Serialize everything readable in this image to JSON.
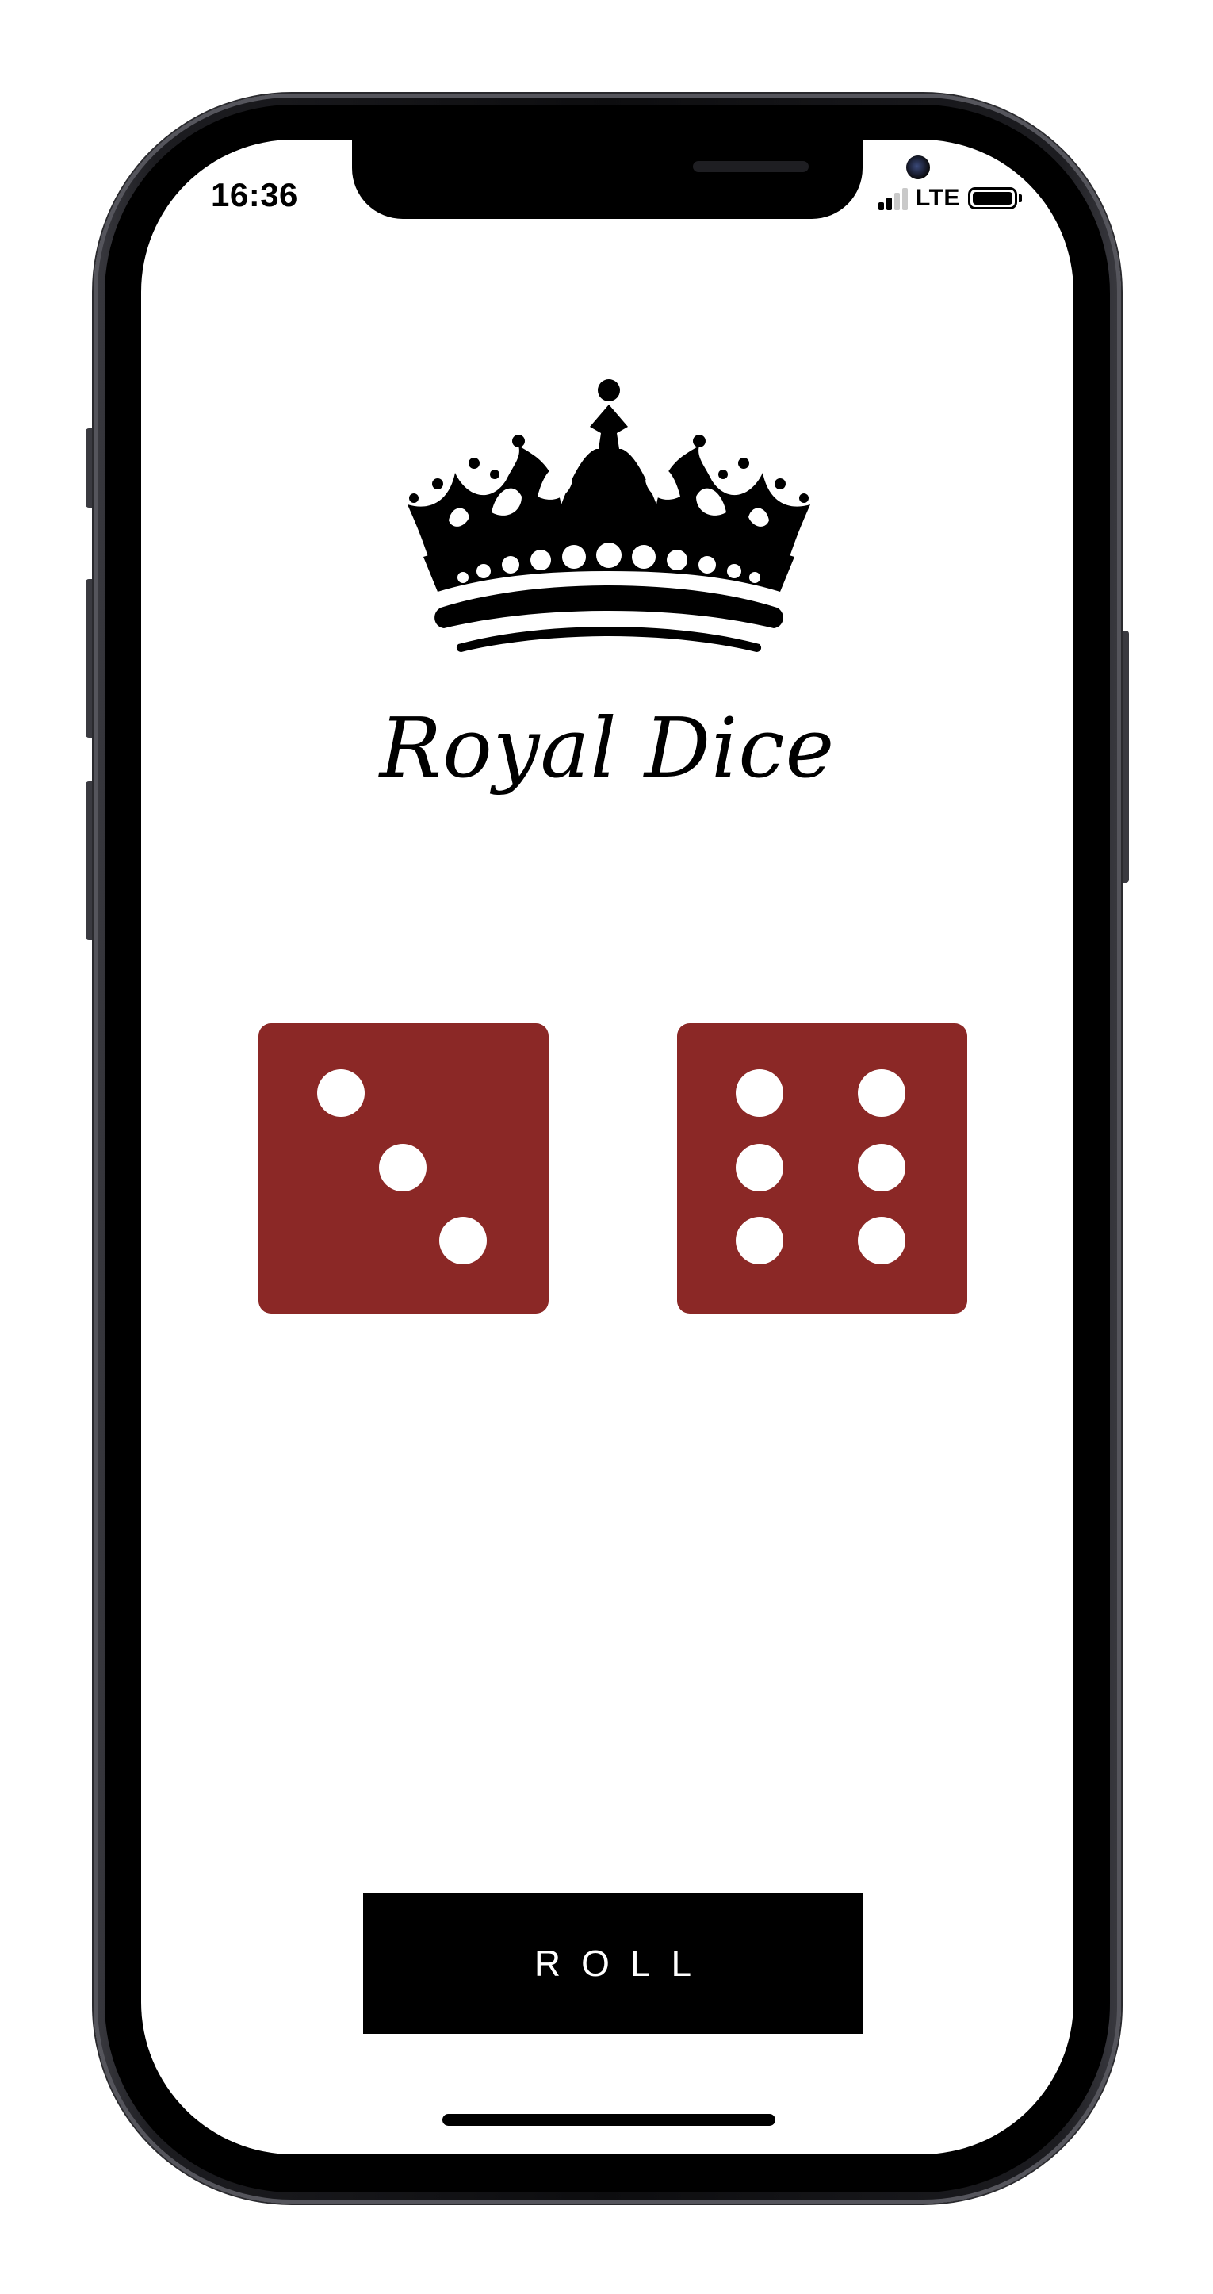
{
  "status_bar": {
    "time": "16:36",
    "network": "LTE",
    "signal_bars_active": 2,
    "signal_bars_total": 4,
    "battery_level": 1.0
  },
  "logo": {
    "icon": "crown-icon",
    "title": "Royal Dice"
  },
  "dice": {
    "color": "#8b2826",
    "pip_color": "#ffffff",
    "left_value": 3,
    "right_value": 6
  },
  "roll_button": {
    "label": "ROLL"
  },
  "colors": {
    "background": "#ffffff",
    "button": "#000000",
    "button_text": "#ffffff"
  }
}
